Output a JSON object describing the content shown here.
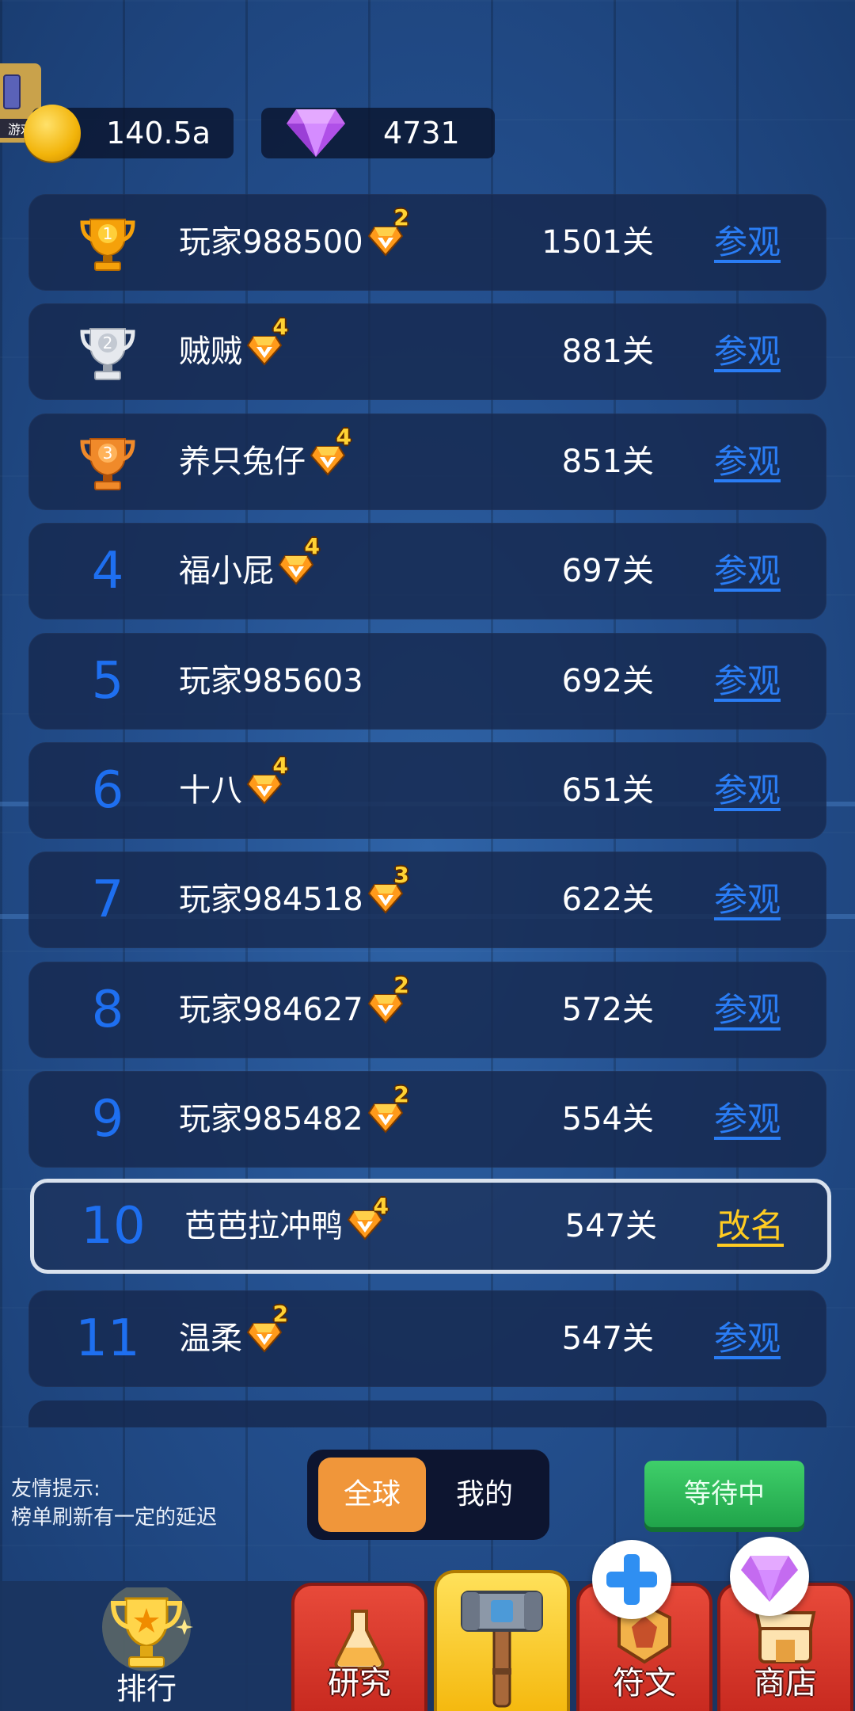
{
  "app_badge": {
    "label": "游戏"
  },
  "currency": {
    "coins": "140.5a",
    "gems": "4731"
  },
  "leaderboard": [
    {
      "rank": "1",
      "name": "玩家988500",
      "vip": "2",
      "level": "1501关",
      "action": "参观",
      "trophy": "gold"
    },
    {
      "rank": "2",
      "name": "贼贼",
      "vip": "4",
      "level": "881关",
      "action": "参观",
      "trophy": "silver"
    },
    {
      "rank": "3",
      "name": "养只兔仔",
      "vip": "4",
      "level": "851关",
      "action": "参观",
      "trophy": "bronze"
    },
    {
      "rank": "4",
      "name": "福小屁",
      "vip": "4",
      "level": "697关",
      "action": "参观"
    },
    {
      "rank": "5",
      "name": "玩家985603",
      "vip": "",
      "level": "692关",
      "action": "参观"
    },
    {
      "rank": "6",
      "name": "十八",
      "vip": "4",
      "level": "651关",
      "action": "参观"
    },
    {
      "rank": "7",
      "name": "玩家984518",
      "vip": "3",
      "level": "622关",
      "action": "参观"
    },
    {
      "rank": "8",
      "name": "玩家984627",
      "vip": "2",
      "level": "572关",
      "action": "参观"
    },
    {
      "rank": "9",
      "name": "玩家985482",
      "vip": "2",
      "level": "554关",
      "action": "参观"
    },
    {
      "rank": "10",
      "name": "芭芭拉冲鸭",
      "vip": "4",
      "level": "547关",
      "action": "改名",
      "is_me": true
    },
    {
      "rank": "11",
      "name": "温柔",
      "vip": "2",
      "level": "547关",
      "action": "参观"
    }
  ],
  "tip": {
    "line1": "友情提示:",
    "line2": "榜单刷新有一定的延迟"
  },
  "scope_toggle": {
    "global": "全球",
    "mine": "我的",
    "selected": "global"
  },
  "status_button": "等待中",
  "nav": {
    "rank": "排行",
    "research": "研究",
    "rune": "符文",
    "shop": "商店"
  },
  "colors": {
    "link": "#2a7df5",
    "rename": "#ffcc22",
    "rank_number": "#1e6ff0",
    "toggle_active": "#f0963a",
    "wait_button": "#2fba58"
  }
}
